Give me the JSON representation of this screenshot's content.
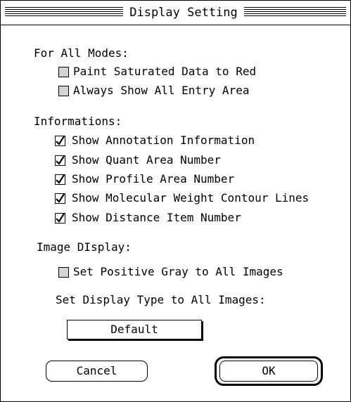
{
  "window": {
    "title": "Display Setting"
  },
  "sections": {
    "all_modes": {
      "label": "For All Modes:",
      "items": [
        {
          "label": "Paint Saturated Data to Red",
          "checked": false
        },
        {
          "label": "Always Show All Entry Area",
          "checked": false
        }
      ]
    },
    "informations": {
      "label": "Informations:",
      "items": [
        {
          "label": "Show Annotation Information",
          "checked": true
        },
        {
          "label": "Show Quant Area Number",
          "checked": true
        },
        {
          "label": "Show Profile Area Number",
          "checked": true
        },
        {
          "label": "Show Molecular Weight Contour Lines",
          "checked": true
        },
        {
          "label": "Show Distance Item Number",
          "checked": true
        }
      ]
    },
    "image_display": {
      "label": "Image DIsplay:",
      "positive_gray": {
        "label": "Set Positive Gray to All Images",
        "checked": false
      },
      "display_type_label": "Set Display Type to All Images:",
      "display_type_value": "Default"
    }
  },
  "buttons": {
    "cancel": "Cancel",
    "ok": "OK"
  },
  "icons": {
    "checkbox_checked": "checkmark-icon"
  }
}
